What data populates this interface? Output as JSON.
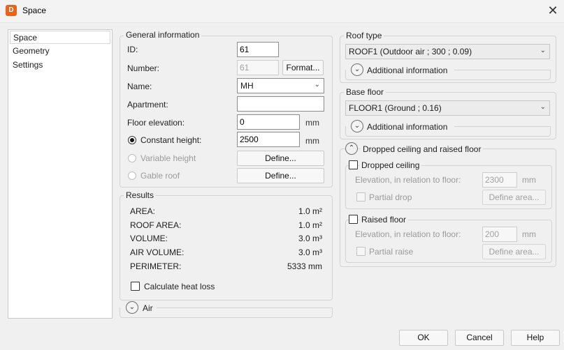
{
  "window": {
    "icon_letter": "D",
    "title": "Space",
    "close_glyph": "✕"
  },
  "nav": {
    "items": [
      "Space",
      "Geometry",
      "Settings"
    ],
    "selected": "Space"
  },
  "general": {
    "legend": "General information",
    "id_label": "ID:",
    "id_value": "61",
    "number_label": "Number:",
    "number_value": "61",
    "format_button": "Format...",
    "name_label": "Name:",
    "name_value": "MH",
    "apartment_label": "Apartment:",
    "apartment_value": "",
    "floor_elev_label": "Floor elevation:",
    "floor_elev_value": "0",
    "floor_elev_unit": "mm",
    "const_height_label": "Constant height:",
    "const_height_value": "2500",
    "const_height_unit": "mm",
    "var_height_label": "Variable height",
    "var_define": "Define...",
    "gable_label": "Gable roof",
    "gable_define": "Define..."
  },
  "results": {
    "legend": "Results",
    "rows": [
      {
        "label": "AREA:",
        "value": "1.0 m²"
      },
      {
        "label": "ROOF AREA:",
        "value": "1.0 m²"
      },
      {
        "label": "VOLUME:",
        "value": "3.0 m³"
      },
      {
        "label": "AIR VOLUME:",
        "value": "3.0 m³"
      },
      {
        "label": "PERIMETER:",
        "value": "5333 mm"
      }
    ],
    "heat_loss_label": "Calculate heat loss"
  },
  "air": {
    "label": "Air"
  },
  "roof": {
    "legend": "Roof type",
    "value": "ROOF1 (Outdoor air ; 300 ; 0.09)",
    "additional": "Additional information"
  },
  "base": {
    "legend": "Base floor",
    "value": "FLOOR1 (Ground ; 0.16)",
    "additional": "Additional information"
  },
  "dropped": {
    "header": "Dropped ceiling and raised floor",
    "ceiling_label": "Dropped ceiling",
    "ceiling_elev_label": "Elevation, in relation to floor:",
    "ceiling_elev_value": "2300",
    "ceiling_unit": "mm",
    "partial_drop": "Partial drop",
    "ceiling_define": "Define area...",
    "raised_label": "Raised floor",
    "raised_elev_label": "Elevation, in relation to floor:",
    "raised_elev_value": "200",
    "raised_unit": "mm",
    "partial_raise": "Partial raise",
    "raised_define": "Define area..."
  },
  "footer": {
    "ok": "OK",
    "cancel": "Cancel",
    "help": "Help"
  }
}
